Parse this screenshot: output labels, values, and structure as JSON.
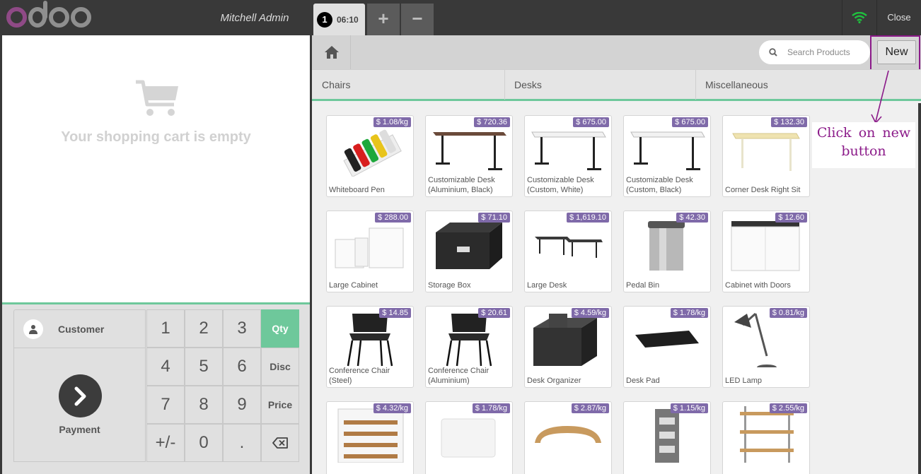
{
  "app": {
    "logo_colors": {
      "o1": "#8f4a86",
      "rest": "#8f8f8f"
    }
  },
  "topbar": {
    "user": "Mitchell Admin",
    "order": {
      "number": "1",
      "time": "06:10"
    },
    "add_label": "+",
    "remove_label": "−",
    "close_label": "Close",
    "wifi_color": "#1fbf3e"
  },
  "cart": {
    "empty_text": "Your shopping cart is empty"
  },
  "actionpad": {
    "customer_label": "Customer",
    "payment_label": "Payment"
  },
  "numpad": {
    "keys": [
      "1",
      "2",
      "3",
      "Qty",
      "4",
      "5",
      "6",
      "Disc",
      "7",
      "8",
      "9",
      "Price",
      "+/-",
      "0",
      ".",
      ""
    ],
    "active_mode": "Qty"
  },
  "search": {
    "placeholder": "Search Products"
  },
  "new_button": {
    "label": "New"
  },
  "categories": [
    "Chairs",
    "Desks",
    "Miscellaneous"
  ],
  "annotation": {
    "text_line1": "Click on new",
    "text_line2": "button"
  },
  "products": [
    {
      "name": "Whiteboard Pen",
      "price": "$ 1.08/kg"
    },
    {
      "name": "Customizable Desk (Aluminium, Black)",
      "price": "$ 720.36"
    },
    {
      "name": "Customizable Desk (Custom, White)",
      "price": "$ 675.00"
    },
    {
      "name": "Customizable Desk (Custom, Black)",
      "price": "$ 675.00"
    },
    {
      "name": "Corner Desk Right Sit",
      "price": "$ 132.30"
    },
    {
      "name": "Large Cabinet",
      "price": "$ 288.00"
    },
    {
      "name": "Storage Box",
      "price": "$ 71.10"
    },
    {
      "name": "Large Desk",
      "price": "$ 1,619.10"
    },
    {
      "name": "Pedal Bin",
      "price": "$ 42.30"
    },
    {
      "name": "Cabinet with Doors",
      "price": "$ 12.60"
    },
    {
      "name": "Conference Chair (Steel)",
      "price": "$ 14.85"
    },
    {
      "name": "Conference Chair (Aluminium)",
      "price": "$ 20.61"
    },
    {
      "name": "Desk Organizer",
      "price": "$ 4.59/kg"
    },
    {
      "name": "Desk Pad",
      "price": "$ 1.78/kg"
    },
    {
      "name": "LED Lamp",
      "price": "$ 0.81/kg"
    },
    {
      "name": "",
      "price": "$ 4.32/kg"
    },
    {
      "name": "",
      "price": "$ 1.78/kg"
    },
    {
      "name": "",
      "price": "$ 2.87/kg"
    },
    {
      "name": "",
      "price": "$ 1.15/kg"
    },
    {
      "name": "",
      "price": "$ 2.55/kg"
    }
  ]
}
